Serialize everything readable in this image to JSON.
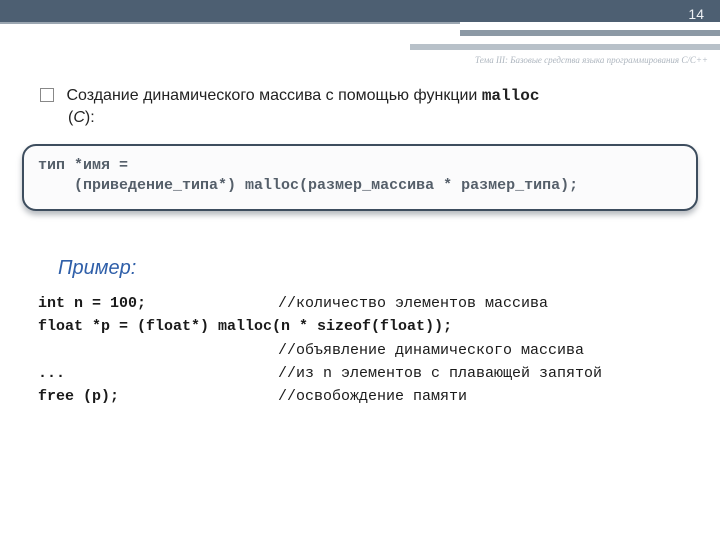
{
  "page_number": "14",
  "chapter": "Тема III: Базовые средства языка программирования C/C++",
  "heading_prefix": "Создание динамического массива с помощью функции ",
  "heading_func": "malloc",
  "heading_tail_open": "(",
  "heading_tail_lang": "С",
  "heading_tail_close": "):",
  "syntax_line1": "тип *имя =",
  "syntax_line2": "    (приведение_типа*) malloc(размер_массива * размер_типа);",
  "example_title": "Пример:",
  "ex": {
    "l1_code": "int n = 100;",
    "l1_cmt": "//количество элементов массива",
    "l2_code": "float *p = (float*) malloc(n * sizeof(float));",
    "l3_cmt": "//объявление динамического массива",
    "l4_code": "...",
    "l4_cmt": "//из n элементов с плавающей запятой",
    "l5_code": "free (p);",
    "l5_cmt": "//освобождение памяти"
  }
}
